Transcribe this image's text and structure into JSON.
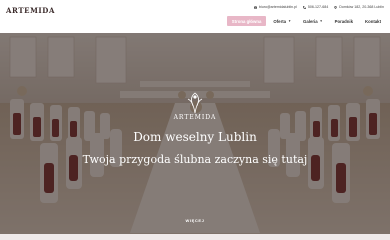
{
  "header": {
    "logo_text": "ARTEMIDA",
    "topbar": {
      "email": "biuro@artemidalublin.pl",
      "phone": "506-127-684",
      "address": "Domków 182, 20-368 Lublin"
    },
    "nav": [
      {
        "label": "Strona główna",
        "active": true
      },
      {
        "label": "Oferta",
        "has_caret": true
      },
      {
        "label": "Galeria",
        "has_caret": true
      },
      {
        "label": "Poradnik"
      },
      {
        "label": "Kontakt"
      }
    ]
  },
  "hero": {
    "brand": "ARTEMIDA",
    "title": "Dom weselny Lublin",
    "subtitle": "Twoja przygoda ślubna zaczyna się tutaj",
    "more_label": "WIĘCEJ"
  },
  "colors": {
    "accent": "#e8b7c7",
    "sash": "#7a2f33"
  }
}
